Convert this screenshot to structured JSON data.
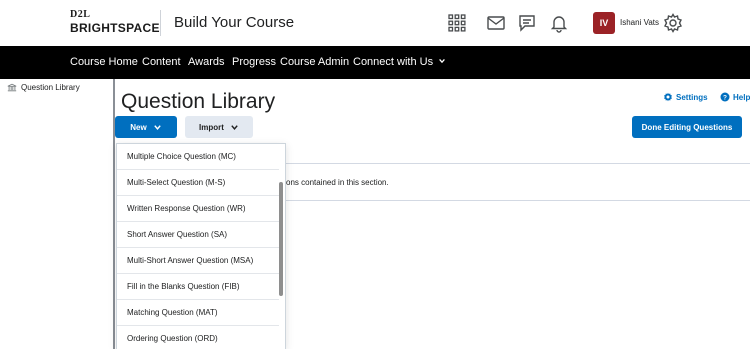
{
  "header": {
    "logo_top": "D2L",
    "logo_bottom": "BRIGHTSPACE",
    "course_title": "Build Your Course",
    "user_initials": "IV",
    "user_name": "Ishani Vats"
  },
  "nav": {
    "items": [
      "Course Home",
      "Content",
      "Awards",
      "Progress",
      "Course Admin",
      "Connect with Us"
    ]
  },
  "sidebar": {
    "item_label": "Question Library"
  },
  "main": {
    "title": "Question Library",
    "settings_label": "Settings",
    "help_label": "Help",
    "new_label": "New",
    "import_label": "Import",
    "done_label": "Done Editing Questions",
    "info_text": "ons contained in this section."
  },
  "dropdown": {
    "items": [
      "Multiple Choice Question (MC)",
      "Multi-Select Question (M-S)",
      "Written Response Question (WR)",
      "Short Answer Question (SA)",
      "Multi-Short Answer Question (MSA)",
      "Fill in the Blanks Question (FIB)",
      "Matching Question (MAT)",
      "Ordering Question (ORD)"
    ]
  },
  "colors": {
    "brand_blue": "#006fbf",
    "nav_bg": "#000000",
    "avatar_bg": "#9b2226"
  }
}
